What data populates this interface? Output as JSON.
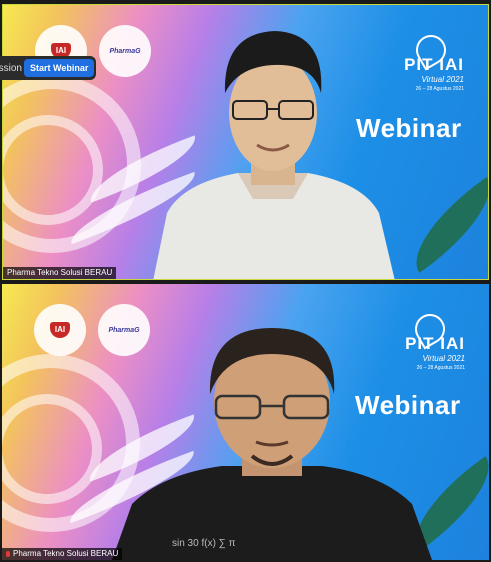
{
  "toolbar": {
    "session_text": "Session",
    "start_webinar_label": "Start Webinar"
  },
  "tiles": [
    {
      "banner_title": "Webinar",
      "event_title": "PIT IAI",
      "event_subtitle": "Virtual 2021",
      "event_dates": "26 – 28 Agustus 2021",
      "logo_iai": "IAI",
      "logo_pharma": "PharmaG",
      "participant_name": "Pharma Tekno Solusi BERAU",
      "muted": false
    },
    {
      "banner_title": "Webinar",
      "event_title": "PIT IAI",
      "event_subtitle": "Virtual 2021",
      "event_dates": "26 – 28 Agustus 2021",
      "logo_iai": "IAI",
      "logo_pharma": "PharmaG",
      "participant_name": "Pharma Tekno Solusi BERAU",
      "muted": true
    }
  ]
}
